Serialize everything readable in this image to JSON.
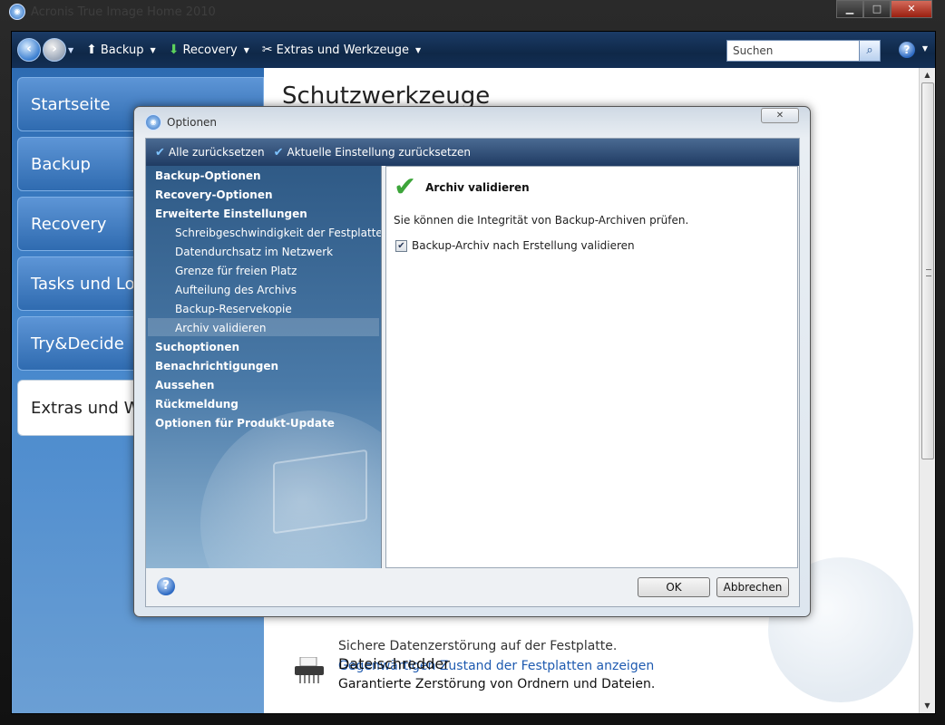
{
  "window": {
    "title": "Acronis True Image Home 2010"
  },
  "toolbar": {
    "menus": [
      {
        "label": "Backup"
      },
      {
        "label": "Recovery"
      },
      {
        "label": "Extras und Werkzeuge"
      }
    ],
    "search_placeholder": "Suchen"
  },
  "sidebar": {
    "items": [
      {
        "label": "Startseite"
      },
      {
        "label": "Backup"
      },
      {
        "label": "Recovery"
      },
      {
        "label": "Tasks und Log"
      },
      {
        "label": "Try&Decide"
      },
      {
        "label": "Extras und We"
      }
    ]
  },
  "main": {
    "title": "Schutzwerkzeuge",
    "items": [
      {
        "line": "Sichere Datenzerstörung auf der Festplatte.",
        "link": "Gegenwärtigen Zustand der Festplatten anzeigen"
      },
      {
        "title": "Dateischredder",
        "desc": "Garantierte Zerstörung von Ordnern und Dateien."
      }
    ]
  },
  "dialog": {
    "title": "Optionen",
    "bar": {
      "reset_all": "Alle zurücksetzen",
      "reset_current": "Aktuelle Einstellung zurücksetzen"
    },
    "tree": [
      {
        "label": "Backup-Optionen",
        "bold": true
      },
      {
        "label": "Recovery-Optionen",
        "bold": true
      },
      {
        "label": "Erweiterte Einstellungen",
        "bold": true
      },
      {
        "label": "Schreibgeschwindigkeit der Festplatte"
      },
      {
        "label": "Datendurchsatz im Netzwerk"
      },
      {
        "label": "Grenze für freien Platz"
      },
      {
        "label": "Aufteilung des Archivs"
      },
      {
        "label": "Backup-Reservekopie"
      },
      {
        "label": "Archiv validieren",
        "selected": true
      },
      {
        "label": "Suchoptionen",
        "bold": true
      },
      {
        "label": "Benachrichtigungen",
        "bold": true
      },
      {
        "label": "Aussehen",
        "bold": true
      },
      {
        "label": "Rückmeldung",
        "bold": true
      },
      {
        "label": "Optionen für Produkt-Update",
        "bold": true
      }
    ],
    "content": {
      "title": "Archiv validieren",
      "description": "Sie können die Integrität von Backup-Archiven prüfen.",
      "checkbox_label": "Backup-Archiv nach Erstellung validieren",
      "checkbox_checked": true
    },
    "buttons": {
      "ok": "OK",
      "cancel": "Abbrechen"
    }
  }
}
